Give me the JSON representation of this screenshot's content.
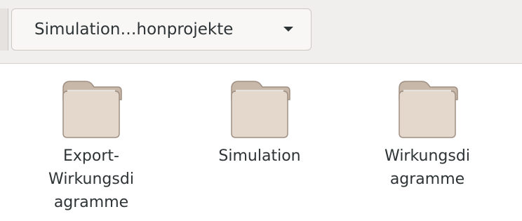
{
  "path_bar": {
    "current_label": "Simulation…honprojekte"
  },
  "folders": [
    {
      "lines": [
        "Export-",
        "Wirkungsdi",
        "agramme"
      ]
    },
    {
      "lines": [
        "Simulation"
      ]
    },
    {
      "lines": [
        "Wirkungsdi",
        "agramme"
      ]
    }
  ],
  "colors": {
    "toolbar_bg": "#f1efed",
    "folder_tab": "#c8b8aa",
    "folder_body": "#e4d8cd",
    "folder_outline": "#9f8f82",
    "text": "#2e3436"
  },
  "icons": {
    "path_dropdown": "chevron-down-icon",
    "folder": "folder-icon"
  }
}
